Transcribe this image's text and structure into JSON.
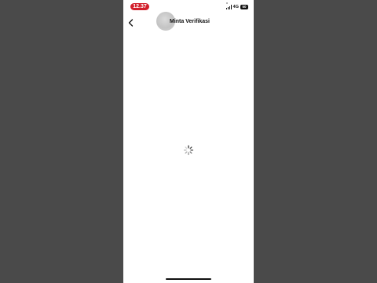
{
  "status_bar": {
    "time": "12.37",
    "network": "4G",
    "battery": "50"
  },
  "header": {
    "title": "Minta Verifikasi",
    "back_icon": "chevron-left-icon"
  },
  "content": {
    "state": "loading",
    "spinner_icon": "loading-spinner-icon"
  },
  "colors": {
    "time_pill": "#d21f2b",
    "background": "#ffffff",
    "backdrop": "#4a4a4a"
  }
}
